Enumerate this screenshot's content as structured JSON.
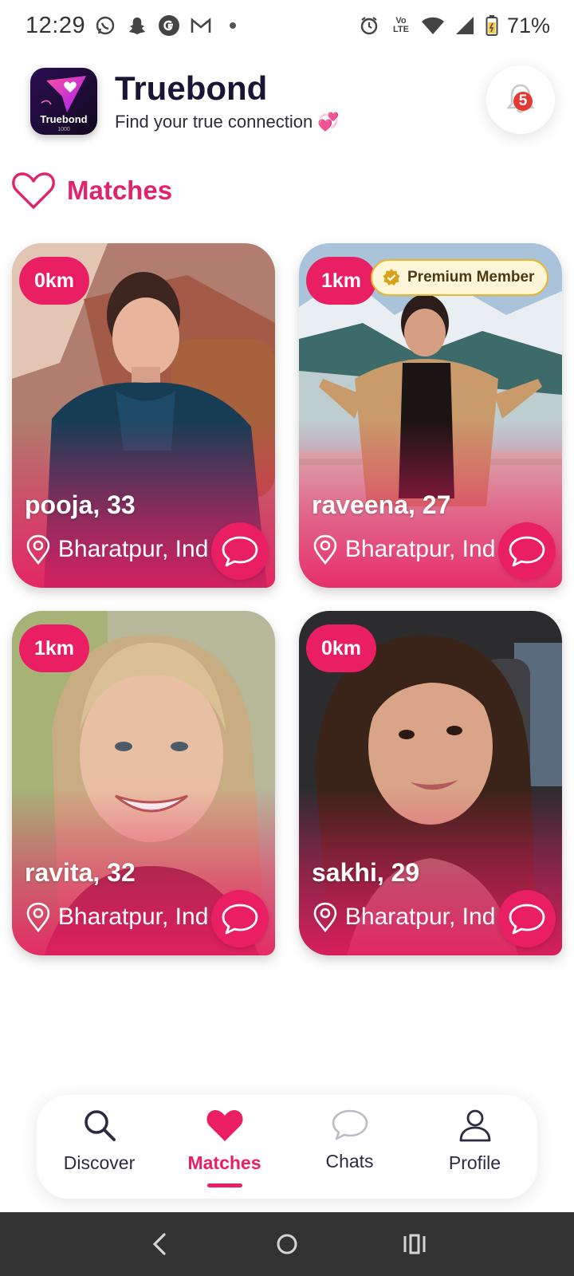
{
  "status_bar": {
    "time": "12:29",
    "battery": "71%",
    "lte_label": "Vo LTE"
  },
  "header": {
    "app_name": "Truebond",
    "tagline": "Find your true connection 💞",
    "logo_text": "Truebond",
    "logo_subtext": "1000",
    "notification_count": "5"
  },
  "section": {
    "title": "Matches"
  },
  "cards": [
    {
      "name": "pooja, 33",
      "distance": "0km",
      "location": "Bharatpur, Ind",
      "premium": ""
    },
    {
      "name": "raveena, 27",
      "distance": "1km",
      "location": "Bharatpur, Ind",
      "premium": "Premium Member"
    },
    {
      "name": "ravita, 32",
      "distance": "1km",
      "location": "Bharatpur, Ind",
      "premium": ""
    },
    {
      "name": "sakhi, 29",
      "distance": "0km",
      "location": "Bharatpur, Ind",
      "premium": ""
    }
  ],
  "bottom_nav": {
    "items": [
      {
        "label": "Discover",
        "icon": "search-icon"
      },
      {
        "label": "Matches",
        "icon": "heart-icon",
        "active": true
      },
      {
        "label": "Chats",
        "icon": "chat-icon"
      },
      {
        "label": "Profile",
        "icon": "user-icon"
      }
    ]
  },
  "colors": {
    "accent": "#e91e63",
    "title_dark": "#1b1535",
    "premium_bg": "#fff6d9",
    "premium_border": "#e8b52c"
  }
}
